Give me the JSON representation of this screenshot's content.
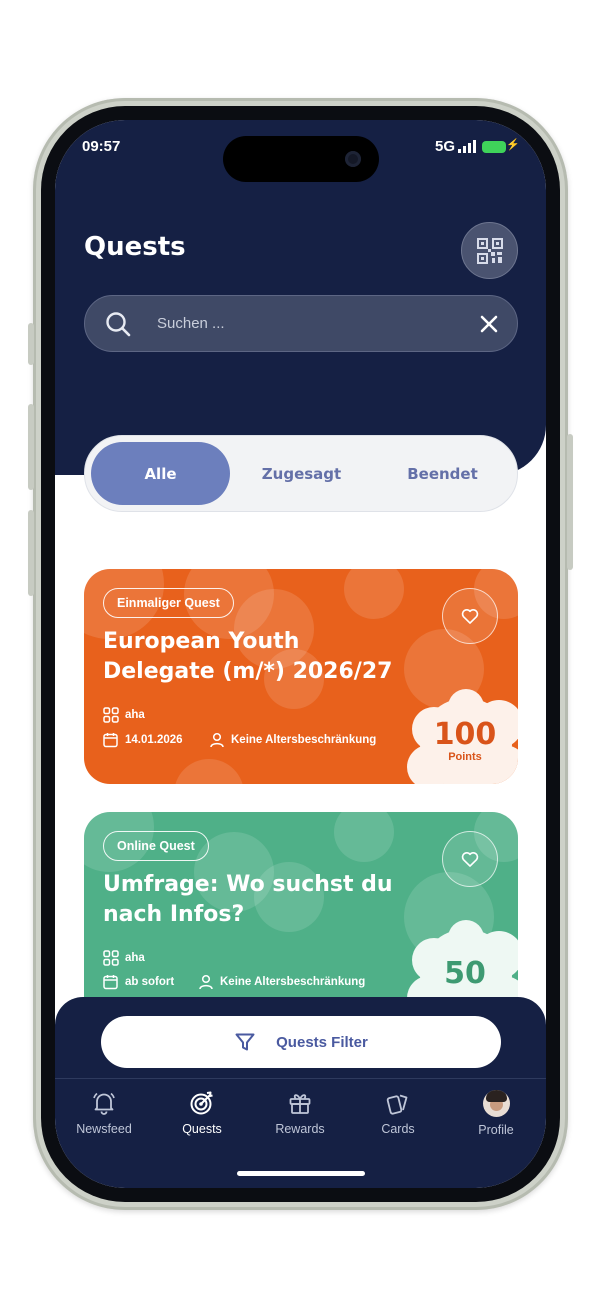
{
  "status_bar": {
    "time": "09:57",
    "network": "5G"
  },
  "header": {
    "title": "Quests",
    "search": {
      "placeholder": "Suchen ..."
    }
  },
  "tabs": [
    {
      "label": "Alle",
      "active": true
    },
    {
      "label": "Zugesagt",
      "active": false
    },
    {
      "label": "Beendet",
      "active": false
    }
  ],
  "quests": [
    {
      "badge": "Einmaliger Quest",
      "title": "European Youth Delegate (m/*) 2026/27",
      "organizer": "aha",
      "date": "14.01.2026",
      "age": "Keine Altersbeschränkung",
      "points_value": "100",
      "points_label": "Points",
      "color": "#e8611c"
    },
    {
      "badge": "Online Quest",
      "title": "Umfrage: Wo suchst du nach Infos?",
      "organizer": "aha",
      "date": "ab sofort",
      "age": "Keine Altersbeschränkung",
      "points_value": "50",
      "color": "#4fb088"
    }
  ],
  "filter_button": {
    "label": "Quests Filter"
  },
  "nav": [
    {
      "label": "Newsfeed",
      "icon": "bell-icon",
      "active": false
    },
    {
      "label": "Quests",
      "icon": "target-icon",
      "active": true
    },
    {
      "label": "Rewards",
      "icon": "gift-icon",
      "active": false
    },
    {
      "label": "Cards",
      "icon": "cards-icon",
      "active": false
    },
    {
      "label": "Profile",
      "icon": "avatar",
      "active": false
    }
  ],
  "colors": {
    "header_bg": "#152044",
    "tab_active": "#6c7fbd",
    "tab_text": "#6470a8",
    "quest_orange": "#e8611c",
    "quest_green": "#4fb088"
  }
}
